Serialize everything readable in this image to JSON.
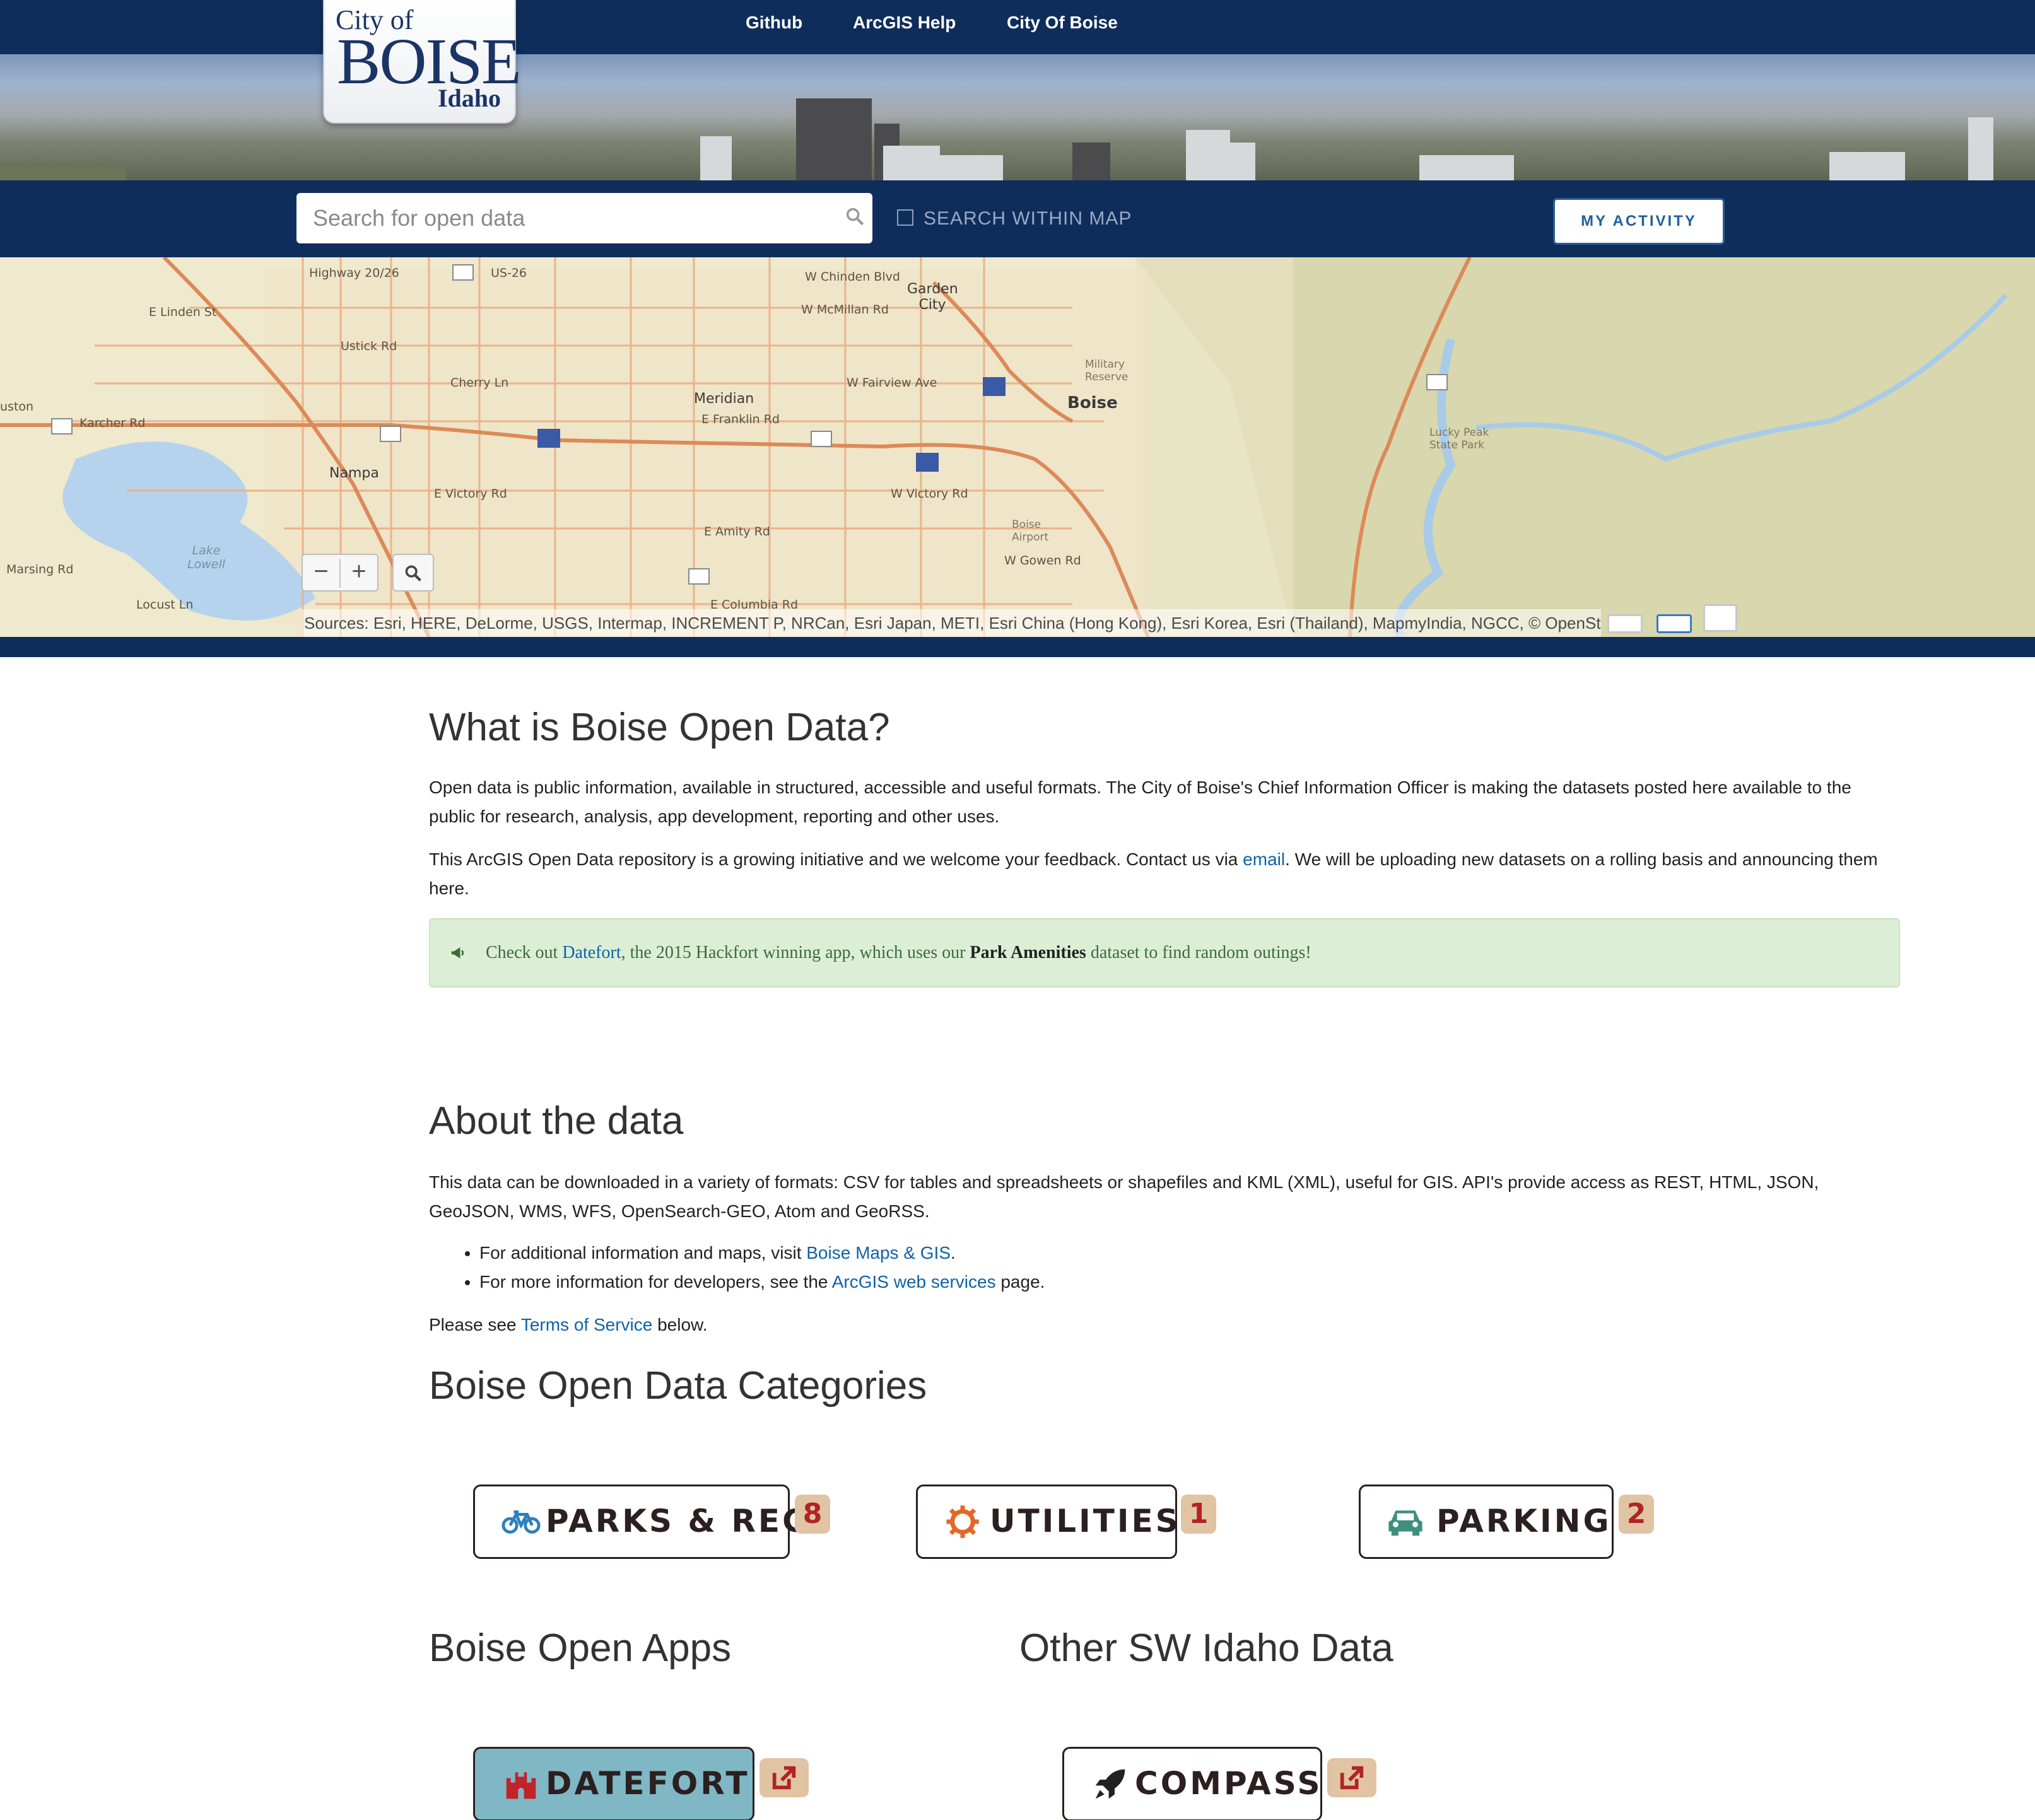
{
  "nav": {
    "links": [
      "Github",
      "ArcGIS Help",
      "City Of Boise"
    ]
  },
  "logo": {
    "line1": "City of",
    "line2": "BOISE",
    "line3": "Idaho"
  },
  "search": {
    "placeholder": "Search for open data",
    "within_map_label": "SEARCH WITHIN MAP",
    "within_map_checked": false,
    "activity_button": "MY ACTIVITY"
  },
  "map": {
    "labels": {
      "boise": "Boise",
      "meridian": "Meridian",
      "nampa": "Nampa",
      "garden_city": "Garden City",
      "lake_lowell": "Lake Lowell",
      "lucky_peak": "Lucky Peak State Park",
      "military": "Military Reserve",
      "airport": "Boise Airport",
      "highway": "Highway 20/26",
      "us26": "US-26",
      "ustick": "Ustick Rd",
      "cherry": "Cherry Ln",
      "fairview": "W Fairview Ave",
      "franklin": "E Franklin Rd",
      "victory": "E Victory Rd",
      "amity": "E Amity Rd",
      "columbia": "E Columbia Rd",
      "locust": "Locust Ln",
      "marsing": "Marsing Rd",
      "karcher": "Karcher Rd",
      "wwictory": "W Victory Rd",
      "gowen": "W Gowen Rd",
      "chinden": "W Chinden Blvd",
      "mcmillan": "W McMillan Rd",
      "linden": "E Linden St",
      "uston": "uston"
    },
    "zoom_out": "−",
    "zoom_in": "+",
    "attribution": "Sources: Esri, HERE, DeLorme, USGS, Intermap, INCREMENT P, NRCan, Esri Japan, METI, Esri China (Hong Kong), Esri Korea, Esri (Thailand), MapmyIndia, NGCC, © OpenStre"
  },
  "intro": {
    "heading": "What is Boise Open Data?",
    "p1": "Open data is public information, available in structured, accessible and useful formats. The City of Boise's Chief Information Officer is making the datasets posted here available to the public for research, analysis, app development, reporting and other uses.",
    "p2_before": "This ArcGIS Open Data repository is a growing initiative and we welcome your feedback. Contact us via ",
    "p2_link": "email",
    "p2_after": ". We will be uploading new datasets on a rolling basis and announcing them here.",
    "alert_before": "Check out ",
    "alert_link": "Datefort",
    "alert_mid": ", the 2015 Hackfort winning app, which uses our ",
    "alert_bold": "Park Amenities",
    "alert_after": " dataset to find random outings!"
  },
  "about": {
    "heading": "About the data",
    "p1": "This data can be downloaded in a variety of formats: CSV for tables and spreadsheets or shapefiles and KML (XML), useful for GIS. API's provide access as REST, HTML, JSON, GeoJSON, WMS, WFS, OpenSearch-GEO, Atom and GeoRSS.",
    "b1_before": "For additional information and maps, visit ",
    "b1_link": "Boise Maps & GIS",
    "b1_after": ".",
    "b2_before": "For more information for developers, see the ",
    "b2_link": "ArcGIS web services",
    "b2_after": " page.",
    "p2_before": "Please see ",
    "p2_link": "Terms of Service",
    "p2_after": " below."
  },
  "categories": {
    "heading": "Boise Open Data Categories",
    "items": [
      {
        "label": "PARKS & REC",
        "count": "8",
        "icon": "bicycle-icon"
      },
      {
        "label": "UTILITIES",
        "count": "1",
        "icon": "gear-icon"
      },
      {
        "label": "PARKING",
        "count": "2",
        "icon": "car-icon"
      }
    ]
  },
  "apps": {
    "heading": "Boise Open Apps",
    "items": [
      {
        "label": "DATEFORT",
        "icon": "castle-icon"
      }
    ]
  },
  "other": {
    "heading": "Other SW Idaho Data",
    "items": [
      {
        "label": "COMPASS",
        "icon": "rocket-icon"
      }
    ]
  },
  "colors": {
    "navy": "#0f2d5b",
    "link": "#0e62a8",
    "alert_bg": "#dcefd6",
    "badge_bg": "#e1c4a3",
    "badge_text": "#b02424",
    "datefort_bg": "#7fb7c5"
  }
}
